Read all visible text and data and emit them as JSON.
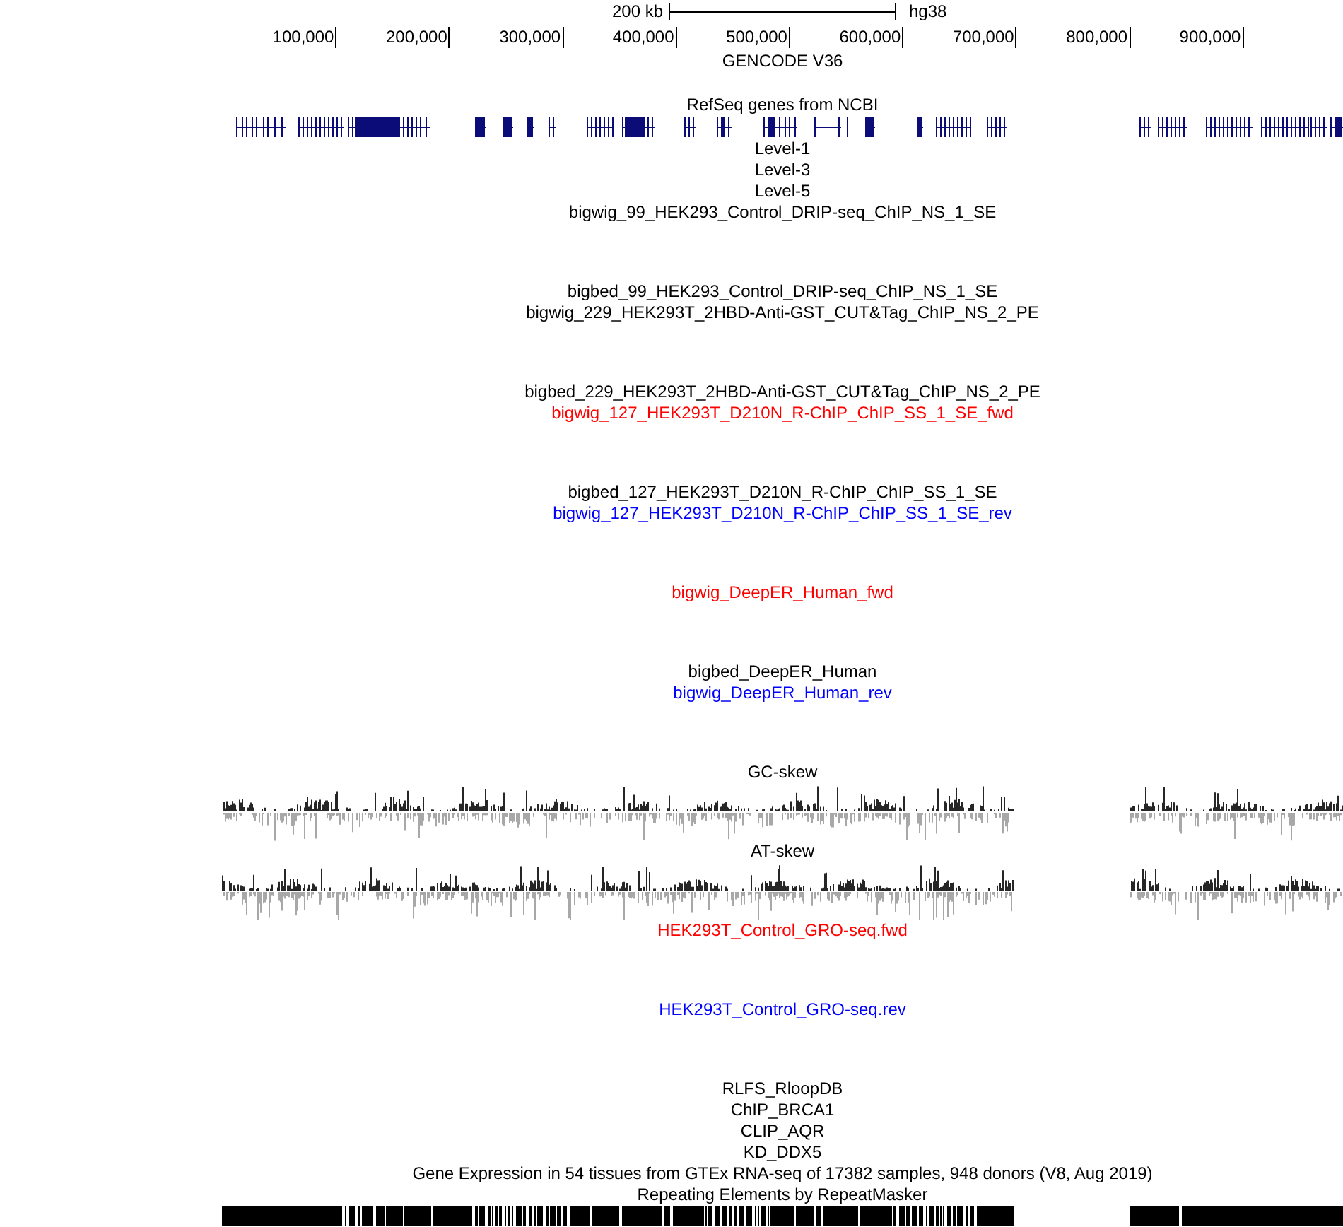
{
  "scale_bar": {
    "length": "200 kb",
    "assembly": "hg38"
  },
  "ruler": {
    "ticks": [
      "100,000",
      "200,000",
      "300,000",
      "400,000",
      "500,000",
      "600,000",
      "700,000",
      "800,000",
      "900,000"
    ]
  },
  "tracks": [
    {
      "kind": "features",
      "label": "GENCODE V36",
      "color": "#000000"
    },
    {
      "kind": "genes",
      "label": "RefSeq genes from NCBI",
      "color": "#000000"
    },
    {
      "kind": "label",
      "label": "Level-1",
      "color": "#000000"
    },
    {
      "kind": "label",
      "label": "Level-3",
      "color": "#000000"
    },
    {
      "kind": "label",
      "label": "Level-5",
      "color": "#000000"
    },
    {
      "kind": "signal",
      "label": "bigwig_99_HEK293_Control_DRIP-seq_ChIP_NS_1_SE",
      "color": "#000000"
    },
    {
      "kind": "label",
      "label": "bigbed_99_HEK293_Control_DRIP-seq_ChIP_NS_1_SE",
      "color": "#000000"
    },
    {
      "kind": "signal",
      "label": "bigwig_229_HEK293T_2HBD-Anti-GST_CUT&Tag_ChIP_NS_2_PE",
      "color": "#000000"
    },
    {
      "kind": "label",
      "label": "bigbed_229_HEK293T_2HBD-Anti-GST_CUT&Tag_ChIP_NS_2_PE",
      "color": "#000000"
    },
    {
      "kind": "signal",
      "label": "bigwig_127_HEK293T_D210N_R-ChIP_ChIP_SS_1_SE_fwd",
      "color": "#ff0000"
    },
    {
      "kind": "label",
      "label": "bigbed_127_HEK293T_D210N_R-ChIP_ChIP_SS_1_SE",
      "color": "#000000"
    },
    {
      "kind": "signal",
      "label": "bigwig_127_HEK293T_D210N_R-ChIP_ChIP_SS_1_SE_rev",
      "color": "#0000ff"
    },
    {
      "kind": "signal",
      "label": "bigwig_DeepER_Human_fwd",
      "color": "#ff0000"
    },
    {
      "kind": "label",
      "label": "bigbed_DeepER_Human",
      "color": "#000000"
    },
    {
      "kind": "signal",
      "label": "bigwig_DeepER_Human_rev",
      "color": "#0000ff"
    },
    {
      "kind": "skew",
      "label": "GC-skew",
      "color": "#000000"
    },
    {
      "kind": "skew",
      "label": "AT-skew",
      "color": "#000000"
    },
    {
      "kind": "signal",
      "label": "HEK293T_Control_GRO-seq.fwd",
      "color": "#ff0000"
    },
    {
      "kind": "signal",
      "label": "HEK293T_Control_GRO-seq.rev",
      "color": "#0000ff"
    },
    {
      "kind": "label",
      "label": "RLFS_RloopDB",
      "color": "#000000"
    },
    {
      "kind": "label",
      "label": "ChIP_BRCA1",
      "color": "#000000"
    },
    {
      "kind": "label",
      "label": "CLIP_AQR",
      "color": "#000000"
    },
    {
      "kind": "label",
      "label": "KD_DDX5",
      "color": "#000000"
    },
    {
      "kind": "label",
      "label": "Gene Expression in 54 tissues from GTEx RNA-seq of 17382 samples, 948 donors (V8, Aug 2019)",
      "color": "#000000"
    },
    {
      "kind": "repeats",
      "label": "Repeating Elements by RepeatMasker",
      "color": "#000000"
    }
  ]
}
